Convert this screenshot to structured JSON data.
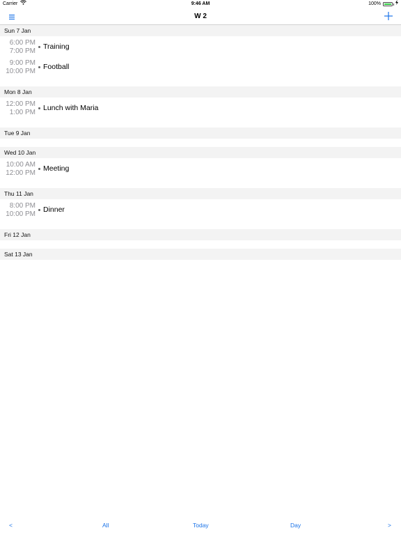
{
  "status_bar": {
    "carrier": "Carrier",
    "time": "9:46 AM",
    "battery_text": "100%",
    "battery_level": 1.0,
    "battery_color": "#2ecc40"
  },
  "nav_bar": {
    "title": "W 2",
    "menu_icon": "hamburger-menu-icon",
    "add_icon": "plus-icon",
    "accent": "#1a73e8"
  },
  "days": [
    {
      "header": "Sun 7 Jan",
      "events": [
        {
          "start": "6:00 PM",
          "end": "7:00 PM",
          "title": "Training"
        },
        {
          "start": "9:00 PM",
          "end": "10:00 PM",
          "title": "Football"
        }
      ]
    },
    {
      "header": "Mon 8 Jan",
      "events": [
        {
          "start": "12:00 PM",
          "end": "1:00 PM",
          "title": "Lunch with Maria"
        }
      ]
    },
    {
      "header": "Tue 9 Jan",
      "events": []
    },
    {
      "header": "Wed 10 Jan",
      "events": [
        {
          "start": "10:00 AM",
          "end": "12:00 PM",
          "title": "Meeting"
        }
      ]
    },
    {
      "header": "Thu 11 Jan",
      "events": [
        {
          "start": "8:00 PM",
          "end": "10:00 PM",
          "title": "Dinner"
        }
      ]
    },
    {
      "header": "Fri 12 Jan",
      "events": []
    },
    {
      "header": "Sat 13 Jan",
      "events": []
    }
  ],
  "toolbar": {
    "prev_label": "<",
    "all_label": "All",
    "today_label": "Today",
    "day_label": "Day",
    "next_label": ">"
  }
}
